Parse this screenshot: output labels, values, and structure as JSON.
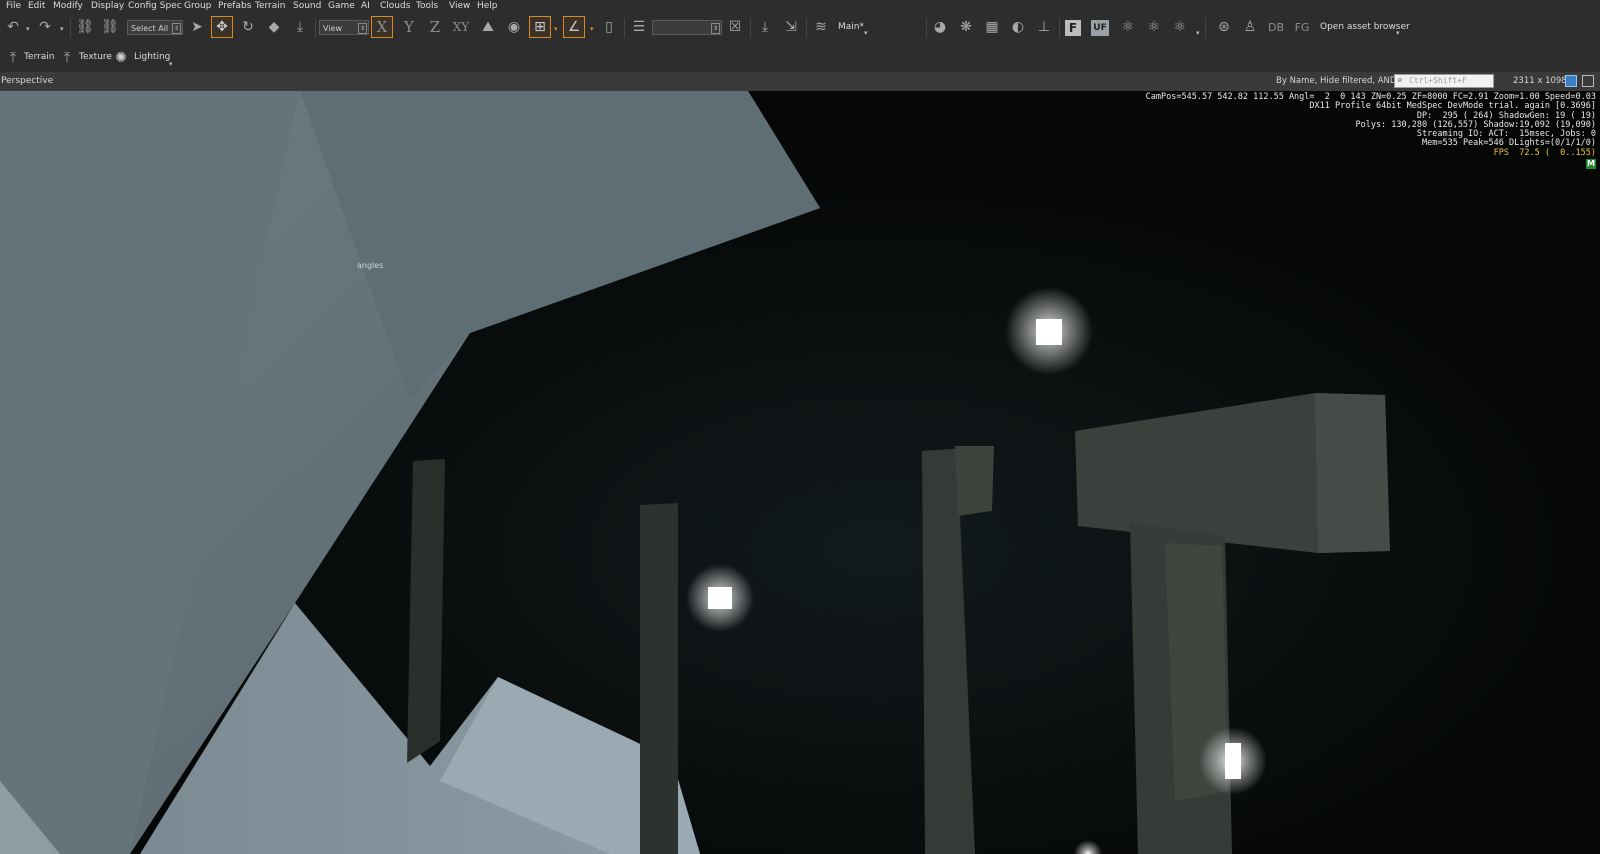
{
  "menu": [
    "File",
    "Edit",
    "Modify",
    "Display",
    "Config Spec",
    "Group",
    "Prefabs",
    "Terrain",
    "Sound",
    "Game",
    "AI",
    "Clouds",
    "Tools",
    "View",
    "Help"
  ],
  "toolbar": {
    "select_combo": "Select All",
    "coord_combo": "View",
    "axis_x": "X",
    "axis_y": "Y",
    "axis_z": "Z",
    "axis_xy": "XY",
    "layer_label": "Main*",
    "f_button": "F",
    "uf_button": "UF",
    "db_button": "DB",
    "fg_button": "FG",
    "asset_browser": "Open asset browser"
  },
  "modes": {
    "terrain": "Terrain",
    "texture": "Texture",
    "lighting": "Lighting"
  },
  "viewport_header": {
    "title": "Perspective",
    "filter_text": "By Name, Hide filtered, AND",
    "search_placeholder": "Ctrl+Shift+F",
    "resolution": "2311 x 1098"
  },
  "stats": {
    "line1": "CamPos=545.57 542.82 112.55 Angl=  2  0 143 ZN=0.25 ZF=8000 FC=2.91 Zoom=1.00 Speed=0.03",
    "line2": "DX11 Profile 64bit MedSpec DevMode trial. again [0.3696]",
    "line3": "DP:  295 ( 264) ShadowGen: 19 ( 19)",
    "line4": "Polys: 130,280 (126,557) Shadow:19,092 (19,090)",
    "line5": "Streaming IO: ACT:  15msec, Jobs: 0",
    "line6": "Mem=535 Peak=546 DLights=(0/1/1/0)",
    "fps": "FPS  72.5 (  0..155)",
    "badge": "M"
  },
  "scene_label": "angles",
  "colors": {
    "accent": "#d98a1f",
    "fps": "#e8c542",
    "badge": "#1f8a2c"
  }
}
